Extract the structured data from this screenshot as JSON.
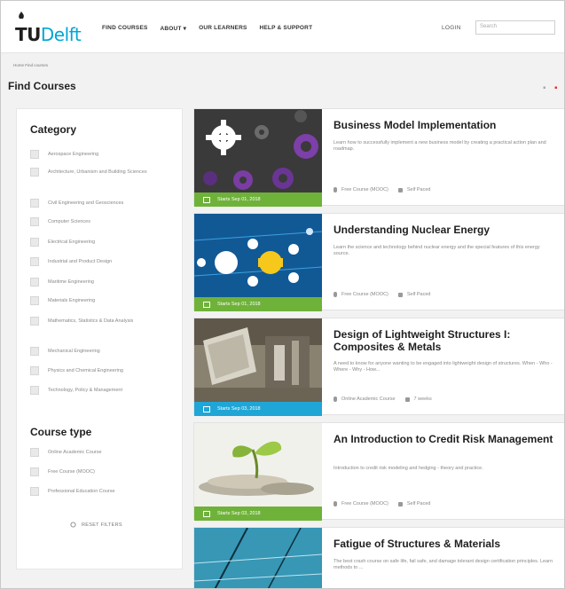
{
  "header": {
    "logo_tu": "TU",
    "logo_delft": "Delft",
    "nav": [
      "FIND COURSES",
      "ABOUT ▾",
      "OUR LEARNERS",
      "HELP & SUPPORT"
    ],
    "login": "LOGIN",
    "search_placeholder": "Search"
  },
  "breadcrumb": "Home Find courses",
  "page_title": "Find Courses",
  "sidebar": {
    "category_heading": "Category",
    "categories": [
      "Aerospace Engineering",
      "Architecture, Urbanism and Building Sciences",
      "Civil Engineering and Geosciences",
      "Computer Sciences",
      "Electrical Engineering",
      "Industrial and Product Design",
      "Maritime Engineering",
      "Materials Engineering",
      "Mathematics, Statistics & Data Analysis",
      "Mechanical Engineering",
      "Physics and Chemical Engineering",
      "Technology, Policy & Management"
    ],
    "course_type_heading": "Course type",
    "course_types": [
      "Online Academic Course",
      "Free Course (MOOC)",
      "Professional Education Course"
    ],
    "reset_label": "RESET FILTERS"
  },
  "courses": [
    {
      "title": "Business Model Implementation",
      "desc": "Learn how to successfully implement a new business model by creating a practical action plan and roadmap.",
      "date": "Starts Sep 01, 2018",
      "type": "Free Course (MOOC)",
      "pace": "Self Paced",
      "bar_color": "#6fb23a"
    },
    {
      "title": "Understanding Nuclear Energy",
      "desc": "Learn the science and technology behind nuclear energy and the special features of this energy source.",
      "date": "Starts Sep 01, 2018",
      "type": "Free Course (MOOC)",
      "pace": "Self Paced",
      "bar_color": "#6fb23a"
    },
    {
      "title": "Design of Lightweight Structures I: Composites & Metals",
      "desc": "A need to know for anyone wanting to be engaged into lightweight design of structures. When - Who - Where - Why - How...",
      "date": "Starts Sep 03, 2018",
      "type": "Online Academic Course",
      "pace": "7 weeks",
      "bar_color": "#1fa6d6"
    },
    {
      "title": "An Introduction to Credit Risk Management",
      "desc": "Introduction to credit risk modeling and hedging - theory and practice.",
      "date": "Starts Sep 03, 2018",
      "type": "Free Course (MOOC)",
      "pace": "Self Paced",
      "bar_color": "#6fb23a"
    },
    {
      "title": "Fatigue of Structures & Materials",
      "desc": "The best crash course on safe life, fail safe, and damage tolerant design certification principles. Learn methods to ...",
      "date": "",
      "type": "",
      "pace": "",
      "bar_color": "#6fb23a"
    }
  ]
}
